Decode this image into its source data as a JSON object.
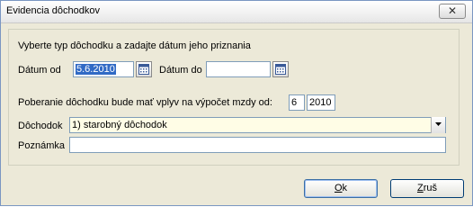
{
  "window": {
    "title": "Evidencia dôchodkov",
    "close_label": "✕"
  },
  "form": {
    "instruction": "Vyberte typ dôchodku a zadajte dátum jeho priznania",
    "date_from_label": "Dátum od",
    "date_from_value": "5.6.2010",
    "date_to_label": "Dátum do",
    "date_to_value": "",
    "effect_label": "Poberanie dôchodku bude mať vplyv na výpočet mzdy od:",
    "effect_month": "6",
    "effect_year": "2010",
    "pension_label": "Dôchodok",
    "pension_value": "1) starobný dôchodok",
    "note_label": "Poznámka",
    "note_value": ""
  },
  "buttons": {
    "ok_key": "O",
    "ok_rest": "k",
    "cancel_key": "Z",
    "cancel_rest": "ruš"
  },
  "icons": {
    "calendar": "calendar-icon",
    "dropdown": "chevron-down-icon",
    "close": "close-icon"
  }
}
